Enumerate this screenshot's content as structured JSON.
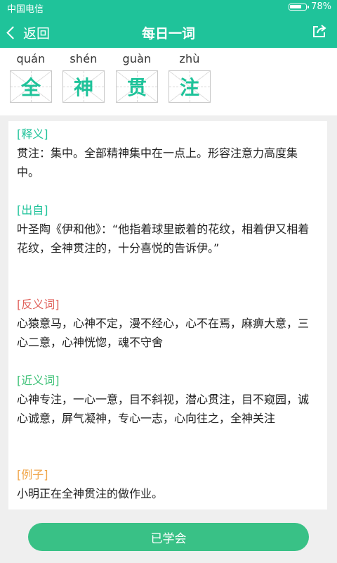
{
  "status": {
    "carrier": "中国电信",
    "battery_percent": "78%",
    "battery_level": 0.78
  },
  "appbar": {
    "back_label": "返回",
    "title": "每日一词"
  },
  "chars": [
    {
      "pinyin": "quán",
      "hanzi": "全"
    },
    {
      "pinyin": "shén",
      "hanzi": "神"
    },
    {
      "pinyin": "guàn",
      "hanzi": "贯"
    },
    {
      "pinyin": "zhù",
      "hanzi": "注"
    }
  ],
  "sections": {
    "meaning": {
      "title": "[释义]",
      "text": "贯注：集中。全部精神集中在一点上。形容注意力高度集中。"
    },
    "source": {
      "title": "[出自]",
      "text": "叶圣陶《伊和他》：“他指着球里嵌着的花纹，相着伊又相着花纹，全神贯注的，十分喜悦的告诉伊。”"
    },
    "antonyms": {
      "title": "[反义词]",
      "text": "心猿意马，心神不定，漫不经心，心不在焉，麻痹大意，三心二意，心神恍惚，魂不守舍"
    },
    "synonyms": {
      "title": "[近义词]",
      "text": "心神专注，一心一意，目不斜视，潜心贯注，目不窥园，诚心诚意，屏气凝神，专心一志，心向往之，全神关注"
    },
    "example": {
      "title": "[例子]",
      "text": "小明正在全神贯注的做作业。"
    }
  },
  "bottom": {
    "learned_label": "已学会"
  },
  "colors": {
    "accent": "#1fc39a",
    "antonym": "#e0625c",
    "synonym": "#3fc278",
    "example": "#f0a64b",
    "button": "#39c186"
  }
}
